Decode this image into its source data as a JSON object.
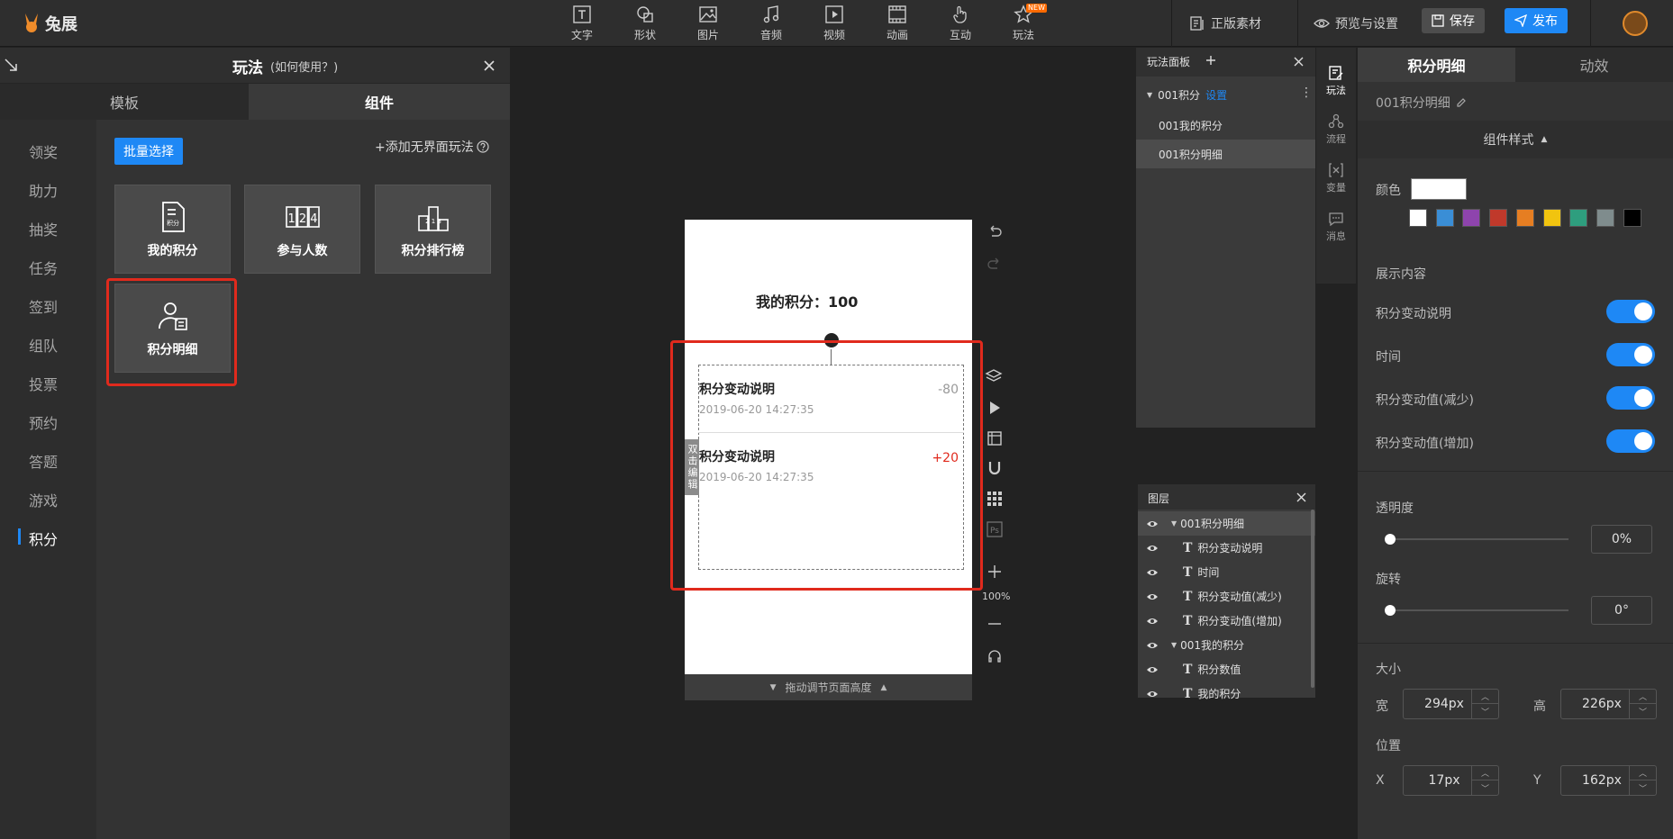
{
  "app": {
    "logo_text": "兔展"
  },
  "toolbar": {
    "tools": [
      "文字",
      "形状",
      "图片",
      "音频",
      "视频",
      "动画",
      "互动",
      "玩法"
    ],
    "new_badge": "NEW",
    "assets": "正版素材",
    "preview": "预览与设置",
    "save": "保存",
    "publish": "发布"
  },
  "left_panel": {
    "title": "玩法",
    "title_hint": "(如何使用？)",
    "tabs": [
      "模板",
      "组件"
    ],
    "categories": [
      "领奖",
      "助力",
      "抽奖",
      "任务",
      "签到",
      "组队",
      "投票",
      "预约",
      "答题",
      "游戏",
      "积分"
    ],
    "active_category": "积分",
    "batch_select": "批量选择",
    "add_link": "+添加无界面玩法",
    "components": [
      "我的积分",
      "参与人数",
      "积分排行榜",
      "积分明细"
    ],
    "icon_text": {
      "points": "积分",
      "counter": "1 2 4",
      "podium": "2 1 3"
    }
  },
  "canvas": {
    "my_points": "我的积分：100",
    "rows": [
      {
        "title": "积分变动说明",
        "time": "2019-06-20 14:27:35",
        "value": "-80",
        "value_color": "#999999"
      },
      {
        "title": "积分变动说明",
        "time": "2019-06-20 14:27:35",
        "value": "+20",
        "value_color": "#e02a1d"
      }
    ],
    "edit_tag": "双击编辑",
    "drag_hint": "拖动调节页面高度",
    "zoom": "100%",
    "side_ps_label": "Ps"
  },
  "gameplay_panel": {
    "title": "玩法面板",
    "group": "001积分",
    "group_action": "设置",
    "items": [
      "001我的积分",
      "001积分明细"
    ],
    "selected_item": "001积分明细"
  },
  "layers": {
    "title": "图层",
    "rows": [
      {
        "label": "001积分明细",
        "type": "group",
        "selected": true
      },
      {
        "label": "积分变动说明",
        "type": "text"
      },
      {
        "label": "时间",
        "type": "text"
      },
      {
        "label": "积分变动值(减少)",
        "type": "text"
      },
      {
        "label": "积分变动值(增加)",
        "type": "text"
      },
      {
        "label": "001我的积分",
        "type": "group"
      },
      {
        "label": "积分数值",
        "type": "text"
      },
      {
        "label": "我的积分",
        "type": "text"
      }
    ],
    "text_glyph": "T"
  },
  "side_nav": [
    "玩法",
    "流程",
    "变量",
    "消息"
  ],
  "right_panel": {
    "tabs": [
      "积分明细",
      "动效"
    ],
    "component_name": "001积分明细",
    "section_title": "组件样式",
    "color_label": "颜色",
    "color_value": "#ffffff",
    "swatches": [
      "#ffffff",
      "#3a8ed6",
      "#8e44ad",
      "#c0392b",
      "#e67e22",
      "#f1c40f",
      "#2e9e7e",
      "#7f8c8d",
      "#000000"
    ],
    "display_label": "展示内容",
    "toggles": [
      {
        "label": "积分变动说明",
        "on": true
      },
      {
        "label": "时间",
        "on": true
      },
      {
        "label": "积分变动值(减少)",
        "on": true
      },
      {
        "label": "积分变动值(增加)",
        "on": true
      }
    ],
    "opacity_label": "透明度",
    "opacity_value": "0%",
    "opacity_level": 0,
    "rotate_label": "旋转",
    "rotate_value": "0°",
    "rotate_level": 0,
    "size_label": "大小",
    "width_label": "宽",
    "width_value": "294px",
    "height_label": "高",
    "height_value": "226px",
    "position_label": "位置",
    "x_label": "X",
    "x_value": "17px",
    "y_label": "Y",
    "y_value": "162px"
  },
  "colors": {
    "accent": "#1e88f5",
    "highlight": "#e02a1d"
  }
}
